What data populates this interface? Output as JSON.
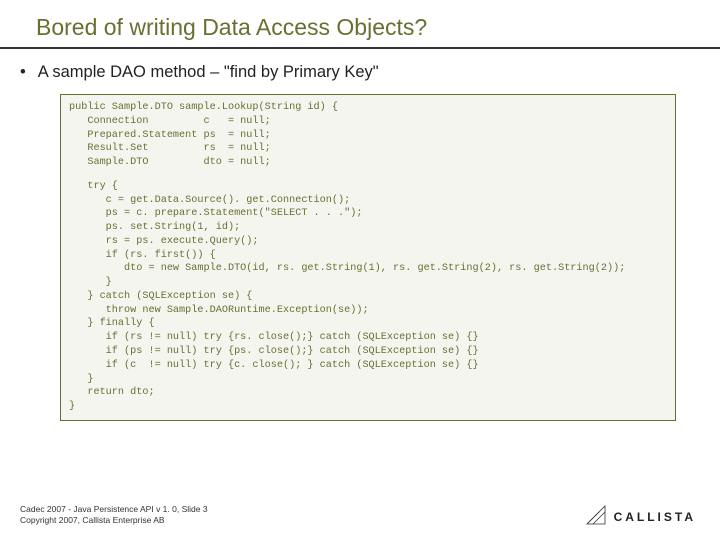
{
  "title": "Bored of writing Data Access Objects?",
  "bullet": "A sample DAO method – \"find by Primary Key\"",
  "code": {
    "block1": "public Sample.DTO sample.Lookup(String id) {\n   Connection         c   = null;\n   Prepared.Statement ps  = null;\n   Result.Set         rs  = null;\n   Sample.DTO         dto = null;",
    "block2": "   try {\n      c = get.Data.Source(). get.Connection();\n      ps = c. prepare.Statement(\"SELECT . . .\");\n      ps. set.String(1, id);\n      rs = ps. execute.Query();\n      if (rs. first()) {\n         dto = new Sample.DTO(id, rs. get.String(1), rs. get.String(2), rs. get.String(2));\n      }\n   } catch (SQLException se) {\n      throw new Sample.DAORuntime.Exception(se));\n   } finally {\n      if (rs != null) try {rs. close();} catch (SQLException se) {}\n      if (ps != null) try {ps. close();} catch (SQLException se) {}\n      if (c  != null) try {c. close(); } catch (SQLException se) {}\n   }\n   return dto;\n}"
  },
  "footer": {
    "line1": "Cadec 2007 - Java Persistence API v 1. 0, Slide 3",
    "line2": "Copyright 2007, Callista Enterprise AB"
  },
  "logo": "CALLISTA"
}
